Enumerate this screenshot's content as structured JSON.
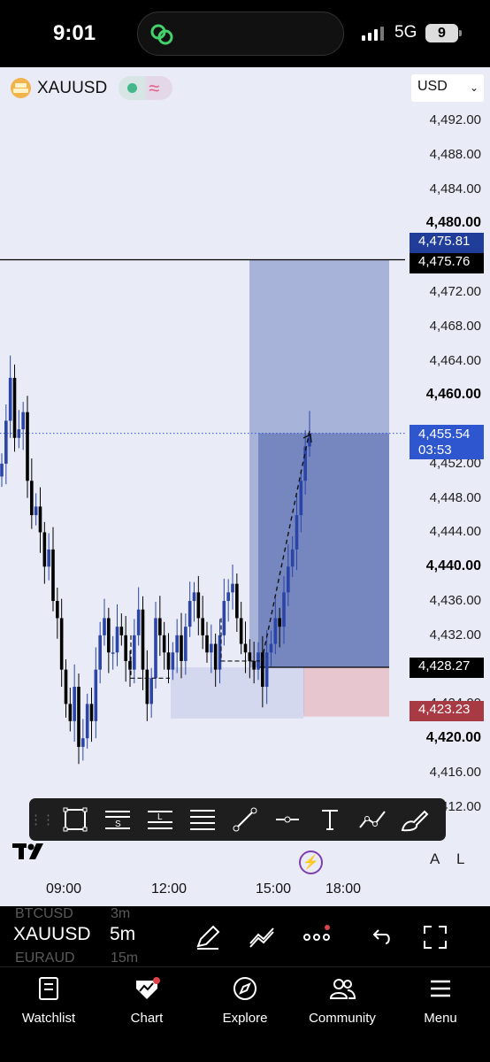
{
  "status_bar": {
    "time": "9:01",
    "network": "5G",
    "battery": "9"
  },
  "header": {
    "symbol": "XAUUSD",
    "currency": "USD"
  },
  "price_scale": {
    "labels": [
      {
        "text": "4,492.00",
        "bold": false
      },
      {
        "text": "4,488.00",
        "bold": false
      },
      {
        "text": "4,484.00",
        "bold": false
      },
      {
        "text": "4,480.00",
        "bold": true
      },
      {
        "text": "4,472.00",
        "bold": false
      },
      {
        "text": "4,468.00",
        "bold": false
      },
      {
        "text": "4,464.00",
        "bold": false
      },
      {
        "text": "4,460.00",
        "bold": true
      },
      {
        "text": "4,452.00",
        "bold": false
      },
      {
        "text": "4,448.00",
        "bold": false
      },
      {
        "text": "4,444.00",
        "bold": false
      },
      {
        "text": "4,440.00",
        "bold": true
      },
      {
        "text": "4,436.00",
        "bold": false
      },
      {
        "text": "4,432.00",
        "bold": false
      },
      {
        "text": "4,424.00",
        "bold": false
      },
      {
        "text": "4,420.00",
        "bold": true
      },
      {
        "text": "4,416.00",
        "bold": false
      },
      {
        "text": "4,412.00",
        "bold": false
      }
    ],
    "tags": {
      "target_upper": "4,475.81",
      "horizontal_line": "4,475.76",
      "current_price": "4,455.54",
      "countdown": "03:53",
      "entry": "4,428.27",
      "stop": "4,423.23"
    }
  },
  "toolbar": {
    "tools": [
      {
        "name": "rectangle-tool",
        "icon": "rectangle-icon"
      },
      {
        "name": "short-position-tool",
        "icon": "short-position-icon",
        "glyph": "S"
      },
      {
        "name": "long-position-tool",
        "icon": "long-position-icon",
        "glyph": "L"
      },
      {
        "name": "fib-retracement-tool",
        "icon": "fib-icon"
      },
      {
        "name": "trend-line-tool",
        "icon": "trend-line-icon"
      },
      {
        "name": "horizontal-ray-tool",
        "icon": "horizontal-ray-icon"
      },
      {
        "name": "text-tool",
        "icon": "text-icon",
        "glyph": "T"
      },
      {
        "name": "path-tool",
        "icon": "path-icon"
      },
      {
        "name": "brush-tool",
        "icon": "brush-icon"
      }
    ]
  },
  "axis_mode": {
    "auto": "A",
    "log": "L"
  },
  "time_axis": {
    "labels": [
      "09:00",
      "12:00",
      "15:00",
      "18:00"
    ]
  },
  "bottom_bar": {
    "symbol": "XAUUSD",
    "interval": "5m",
    "ghost_symbols": [
      {
        "symbol": "BTCUSD",
        "interval": "3m"
      },
      {
        "symbol": "EURAUD",
        "interval": "15m"
      }
    ]
  },
  "tabbar": {
    "tabs": [
      "Watchlist",
      "Chart",
      "Explore",
      "Community",
      "Menu"
    ]
  },
  "colors": {
    "chart_bg": "#e9ecf7",
    "up_candle": "#2a44a8",
    "down_candle": "#000000",
    "target_zone": "#a8b3da",
    "stop_zone": "#e8c6cf",
    "price_tag_blue": "#2d56cf",
    "price_tag_red": "#a73a43"
  },
  "chart_data": {
    "type": "candlestick",
    "symbol": "XAUUSD",
    "interval": "5m",
    "ylim": [
      4410,
      4495
    ],
    "x_ticks": [
      "09:00",
      "12:00",
      "15:00",
      "18:00"
    ],
    "last_price": 4455.54,
    "position": {
      "side": "long",
      "entry": 4428.27,
      "target": 4475.81,
      "stop": 4423.23
    },
    "horizontal_line": 4475.76,
    "close_path": [
      4452,
      4457,
      4462,
      4455,
      4456,
      4458,
      4450,
      4446,
      4447,
      4444,
      4440,
      4442,
      4436,
      4434,
      4428,
      4424,
      4422,
      4426,
      4419,
      4420,
      4424,
      4422,
      4428,
      4432,
      4434,
      4430,
      4430,
      4433,
      4432,
      4429,
      4428,
      4432,
      4435,
      4428,
      4424,
      4427,
      4434,
      4432,
      4430,
      4428,
      4430,
      4432,
      4429,
      4433,
      4436,
      4437,
      4434,
      4432,
      4430,
      4431,
      4428,
      4432,
      4436,
      4437,
      4438,
      4434,
      4431,
      4430,
      4429,
      4428,
      4430,
      4426,
      4430,
      4431,
      4434,
      4433,
      4437,
      4440,
      4442,
      4446,
      4450,
      4454,
      4455.54
    ]
  }
}
